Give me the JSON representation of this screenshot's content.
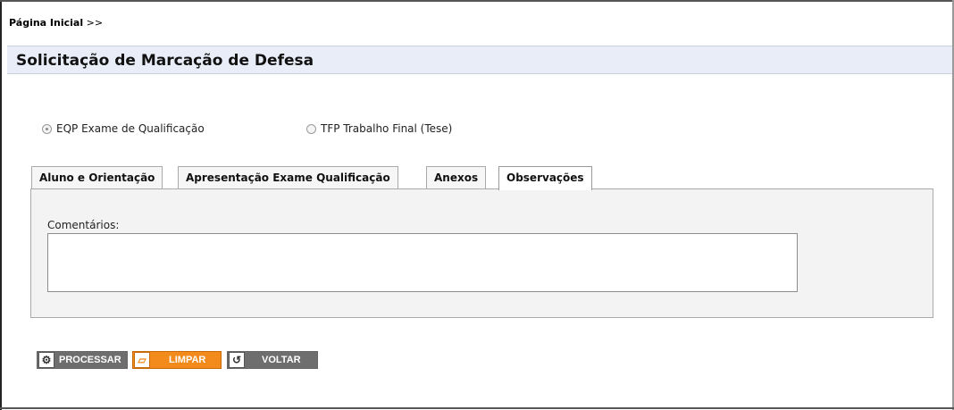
{
  "breadcrumb": {
    "link": "Página Inicial",
    "separator": " >>"
  },
  "page_title": "Solicitação de Marcação de Defesa",
  "radios": [
    {
      "label": "EQP Exame de Qualificação",
      "checked": true
    },
    {
      "label": "TFP Trabalho Final (Tese)",
      "checked": false
    }
  ],
  "tabs": [
    {
      "label": "Aluno e Orientação",
      "active": false
    },
    {
      "label": "Apresentação Exame Qualificação",
      "active": false
    },
    {
      "label": "Anexos",
      "active": false
    },
    {
      "label": "Observações",
      "active": true
    }
  ],
  "observacoes": {
    "comments_label": "Comentários:",
    "comments_value": ""
  },
  "buttons": {
    "processar": {
      "label": "PROCESSAR",
      "icon": "gears-icon"
    },
    "limpar": {
      "label": "LIMPAR",
      "icon": "eraser-icon"
    },
    "voltar": {
      "label": "VOLTAR",
      "icon": "back-arrow-icon"
    }
  },
  "colors": {
    "title_bar": "#e8edf7",
    "limpar_accent": "#f28a1c",
    "button_gray": "#6e6e6e"
  }
}
